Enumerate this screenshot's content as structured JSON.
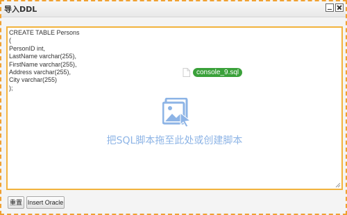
{
  "dialog": {
    "title": "导入DDL"
  },
  "editor": {
    "lines": [
      "CREATE TABLE Persons",
      "(",
      "PersonID int,",
      "LastName varchar(255),",
      "FirstName varchar(255),",
      "Address varchar(255),",
      "City varchar(255)",
      ");"
    ],
    "dragged_file": "console_9.sql",
    "drop_hint": "把SQL脚本拖至此处或创建脚本"
  },
  "buttons": {
    "reset_label": "重置",
    "insert_label": "Insert Oracle"
  },
  "colors": {
    "border_accent": "#f0a030",
    "drop_hint": "#8db4e6",
    "file_chip": "#3aa13a"
  },
  "icons": {
    "drop": "image-drop-icon",
    "file": "file-icon",
    "minimize": "minimize-icon",
    "close": "close-icon"
  }
}
